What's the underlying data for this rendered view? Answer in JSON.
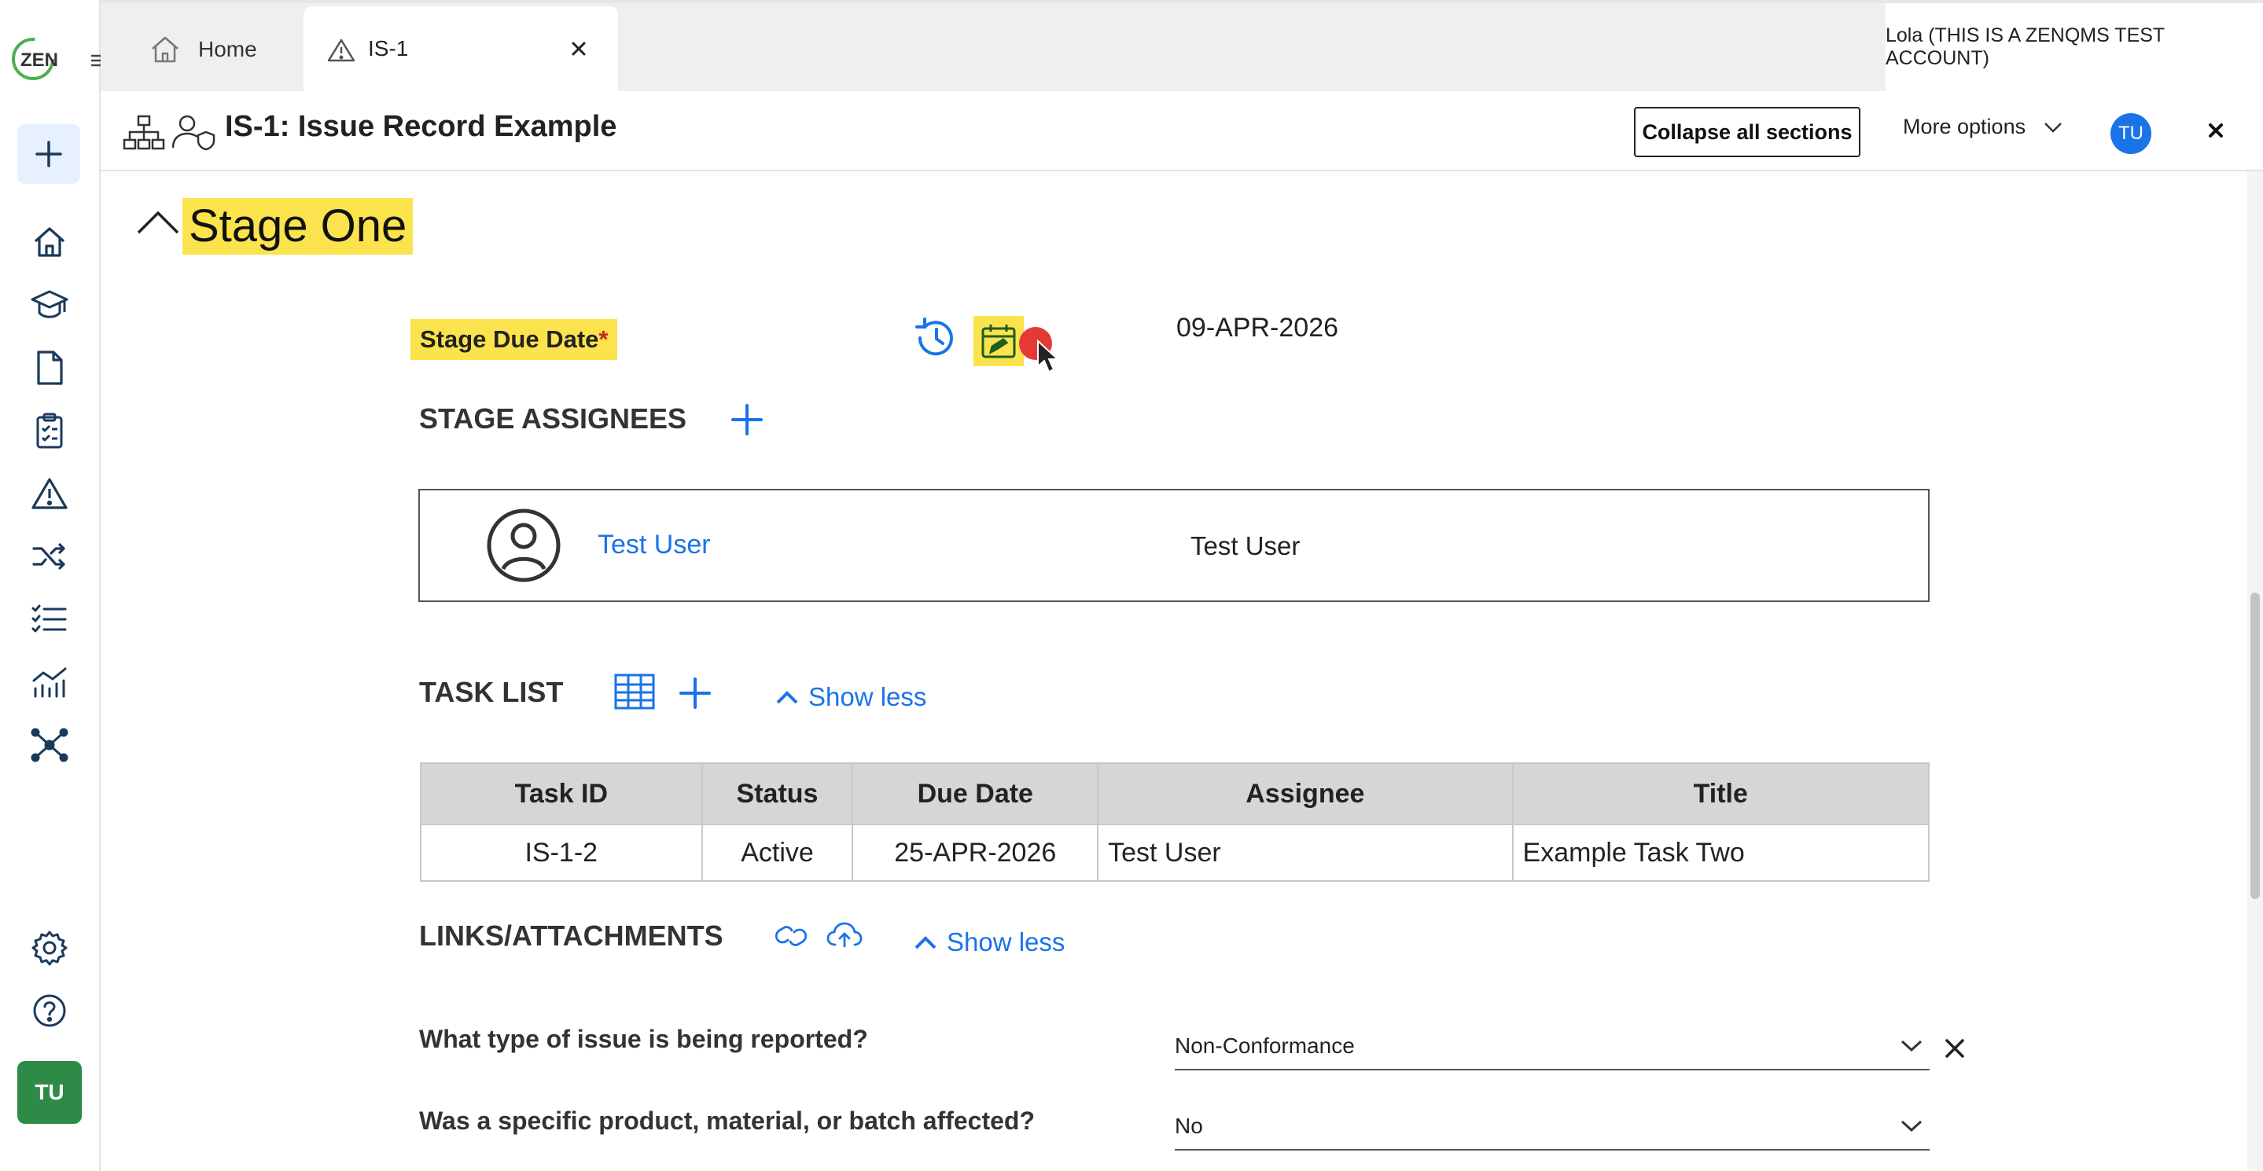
{
  "app": {
    "logo_text": "ZEN",
    "user_account": "Lola (THIS IS A ZENQMS TEST ACCOUNT)",
    "user_initials": "TU"
  },
  "tabs": [
    {
      "label": "Home"
    },
    {
      "label": "IS-1"
    }
  ],
  "header": {
    "title": "IS-1: Issue Record Example",
    "collapse_label": "Collapse all sections",
    "more_options_label": "More options",
    "avatar_initials": "TU"
  },
  "stage": {
    "title": "Stage One",
    "due_date_label": "Stage Due Date",
    "required_mark": "*",
    "due_date_value": "09-APR-2026"
  },
  "assignees": {
    "heading": "STAGE ASSIGNEES",
    "items": [
      {
        "link": "Test User",
        "name": "Test User"
      }
    ]
  },
  "tasks": {
    "heading": "TASK LIST",
    "show_less": "Show less",
    "columns": [
      "Task ID",
      "Status",
      "Due Date",
      "Assignee",
      "Title"
    ],
    "rows": [
      {
        "id": "IS-1-2",
        "status": "Active",
        "due": "25-APR-2026",
        "assignee": "Test User",
        "title": "Example Task Two"
      }
    ]
  },
  "links": {
    "heading": "LINKS/ATTACHMENTS",
    "show_less": "Show less"
  },
  "questions": [
    {
      "label": "What type of issue is being reported?",
      "value": "Non-Conformance"
    },
    {
      "label": "Was a specific product, material, or batch affected?",
      "value": "No"
    }
  ],
  "colors": {
    "accent": "#1a73e8",
    "highlight": "#fbe34d",
    "rail_avatar": "#2e8b47",
    "cursor_dot": "#e53935"
  }
}
